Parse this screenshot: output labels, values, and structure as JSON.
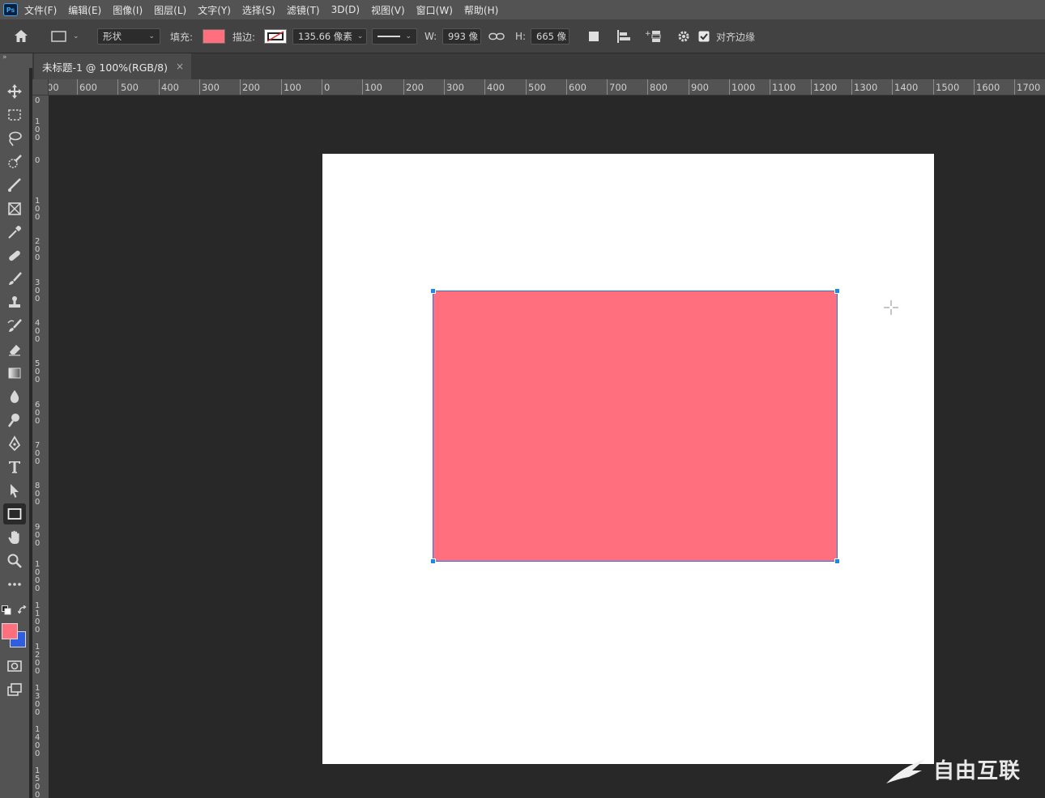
{
  "app": {
    "logo_text": "Ps"
  },
  "menu": [
    "文件(F)",
    "编辑(E)",
    "图像(I)",
    "图层(L)",
    "文字(Y)",
    "选择(S)",
    "滤镜(T)",
    "3D(D)",
    "视图(V)",
    "窗口(W)",
    "帮助(H)"
  ],
  "options": {
    "mode": "形状",
    "fill_label": "填充:",
    "fill_color": "#ff6f7d",
    "stroke_label": "描边:",
    "stroke_width": "135.66 像素",
    "w_label": "W:",
    "w_value": "993 像",
    "h_label": "H:",
    "h_value": "665 像",
    "align_edges": "对齐边缘",
    "align_edges_checked": true
  },
  "tab": {
    "title": "未标题-1 @ 100%(RGB/8)",
    "close": "×",
    "panel_collapse": "»"
  },
  "ruler_h_labels": [
    "00",
    "600",
    "500",
    "400",
    "300",
    "200",
    "100",
    "0",
    "100",
    "200",
    "300",
    "400",
    "500",
    "600",
    "700",
    "800",
    "900",
    "1000",
    "1100",
    "1200",
    "1300",
    "1400",
    "1500",
    "1600",
    "1700"
  ],
  "ruler_v_labels": [
    "0",
    "100",
    "0",
    "100",
    "200",
    "300",
    "400",
    "500",
    "600",
    "700",
    "800",
    "900",
    "1000",
    "1100",
    "1200",
    "1300",
    "1400",
    "1500"
  ],
  "colors": {
    "foreground": "#ff6f7d",
    "background": "#2f5fe0",
    "shape_fill": "#ff6f7d",
    "selection": "#1e88e5"
  },
  "tools": [
    "move-tool-icon",
    "marquee-tool-icon",
    "lasso-tool-icon",
    "quick-select-tool-icon",
    "crop-tool-icon",
    "frame-tool-icon",
    "eyedropper-tool-icon",
    "healing-tool-icon",
    "brush-tool-icon",
    "stamp-tool-icon",
    "history-brush-tool-icon",
    "eraser-tool-icon",
    "gradient-tool-icon",
    "blur-tool-icon",
    "dodge-tool-icon",
    "pen-tool-icon",
    "type-tool-icon",
    "path-select-tool-icon",
    "rectangle-tool-icon",
    "hand-tool-icon",
    "zoom-tool-icon",
    "more-tools-icon"
  ],
  "watermark": {
    "text": "自由互联"
  }
}
